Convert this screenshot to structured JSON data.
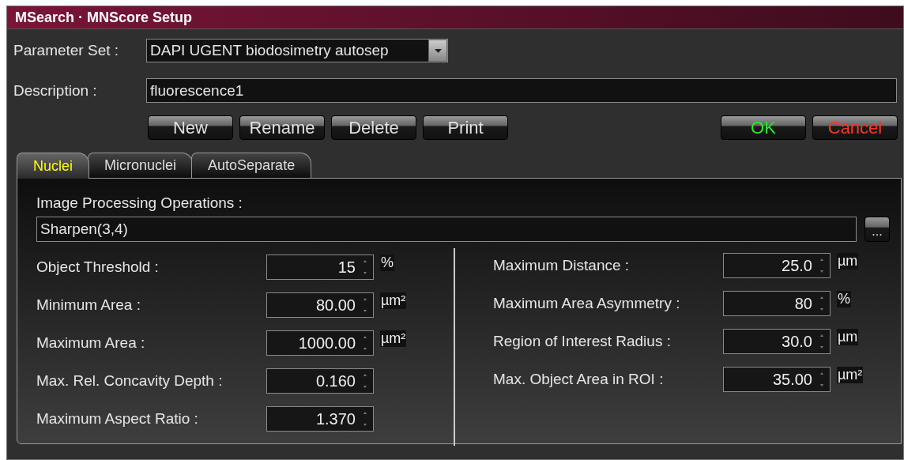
{
  "window": {
    "title": "MSearch · MNScore Setup"
  },
  "parameter_set": {
    "label": "Parameter Set :",
    "value": "DAPI UGENT biodosimetry autosep"
  },
  "description": {
    "label": "Description :",
    "value": "fluorescence1"
  },
  "buttons": [
    {
      "label": "New",
      "kind": "normal"
    },
    {
      "label": "Rename",
      "kind": "normal"
    },
    {
      "label": "Delete",
      "kind": "normal"
    },
    {
      "label": "Print",
      "kind": "normal"
    },
    {
      "label": "OK",
      "kind": "ok"
    },
    {
      "label": "Cancel",
      "kind": "cancel"
    }
  ],
  "tabs": [
    {
      "label": "Nuclei",
      "selected": true
    },
    {
      "label": "Micronuclei",
      "selected": false
    },
    {
      "label": "AutoSeparate",
      "selected": false
    }
  ],
  "image_processing": {
    "label": "Image Processing Operations :",
    "value": "Sharpen(3,4)",
    "browse_button": "..."
  },
  "left_params": [
    {
      "label": "Object Threshold :",
      "value": "15",
      "unit": "%"
    },
    {
      "label": "Minimum Area :",
      "value": "80.00",
      "unit": "µm²"
    },
    {
      "label": "Maximum Area :",
      "value": "1000.00",
      "unit": "µm²"
    },
    {
      "label": "Max. Rel. Concavity Depth :",
      "value": "0.160"
    },
    {
      "label": "Maximum Aspect Ratio :",
      "value": "1.370"
    }
  ],
  "right_params": [
    {
      "label": "Maximum Distance :",
      "value": "25.0",
      "unit": "µm"
    },
    {
      "label": "Maximum Area Asymmetry :",
      "value": "80",
      "unit": "%"
    },
    {
      "label": "Region of Interest Radius :",
      "value": "30.0",
      "unit": "µm"
    },
    {
      "label": "Max. Object Area in ROI :",
      "value": "35.00",
      "unit": "µm²"
    }
  ]
}
